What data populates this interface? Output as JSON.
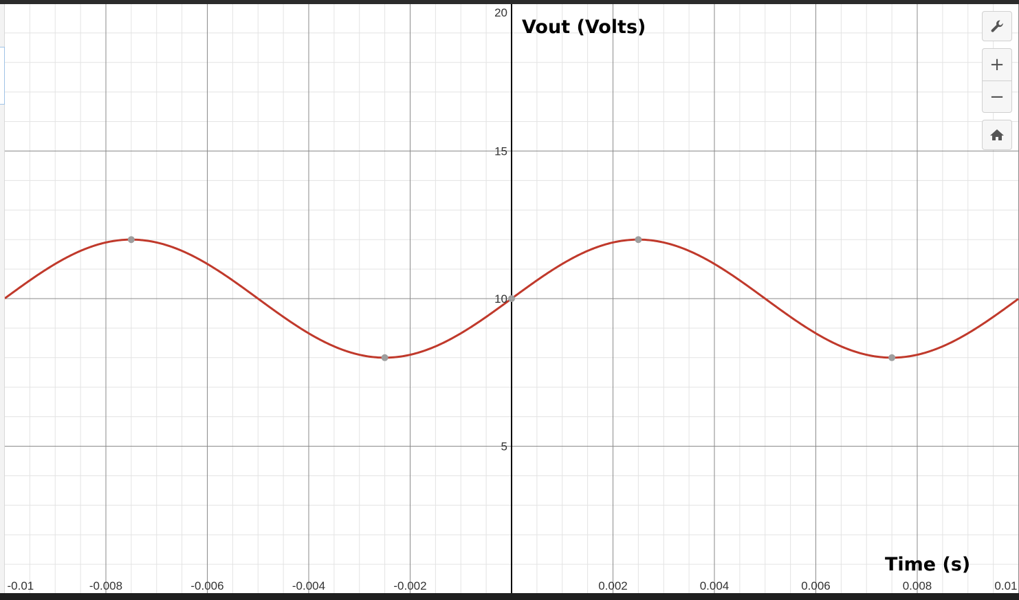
{
  "chart_data": {
    "type": "line",
    "ylabel": "Vout (Volts)",
    "xlabel": "Time (s)",
    "xlim": [
      -0.01,
      0.01
    ],
    "ylim": [
      0,
      20
    ],
    "x_ticks": [
      -0.01,
      -0.008,
      -0.006,
      -0.004,
      -0.002,
      0.002,
      0.004,
      0.006,
      0.008,
      0.01
    ],
    "x_tick_labels": [
      "-0.01",
      "-0.008",
      "-0.006",
      "-0.004",
      "-0.002",
      "0.002",
      "0.004",
      "0.006",
      "0.008",
      "0.01"
    ],
    "y_ticks": [
      5,
      10,
      15,
      20
    ],
    "y_tick_labels": [
      "5",
      "10",
      "15",
      "20"
    ],
    "grid": true,
    "series": [
      {
        "function": "10 + 2*sin(2*pi*100*t)",
        "offset": 10,
        "amplitude": 2,
        "frequency": 100,
        "color": "#c0392b",
        "marked_points": [
          {
            "x": -0.0075,
            "y": 12
          },
          {
            "x": -0.0025,
            "y": 8
          },
          {
            "x": 0,
            "y": 10
          },
          {
            "x": 0.0025,
            "y": 12
          },
          {
            "x": 0.0075,
            "y": 8
          }
        ]
      }
    ]
  },
  "toolbar": {
    "settings_icon": "wrench-icon",
    "zoom_in_label": "+",
    "zoom_out_label": "−",
    "home_icon": "home-icon"
  },
  "colors": {
    "curve": "#c0392b",
    "point": "#9e9e9e",
    "grid_major": "#8a8a8a",
    "grid_minor": "#e3e3e3",
    "axis": "#000000"
  }
}
